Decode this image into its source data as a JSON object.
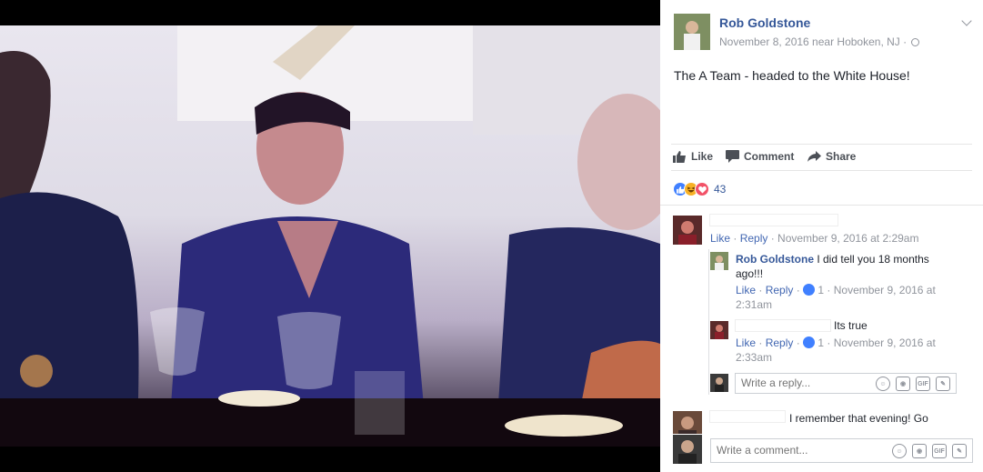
{
  "post": {
    "author": "Rob Goldstone",
    "date_location": "November 8, 2016 near Hoboken, NJ ·",
    "text": "The A Team - headed to the White House!"
  },
  "actions": {
    "like": "Like",
    "comment": "Comment",
    "share": "Share"
  },
  "reactions": {
    "count": "43",
    "types": [
      "like-icon",
      "haha-icon",
      "love-icon"
    ]
  },
  "comments": [
    {
      "links": {
        "like": "Like",
        "sep1": " · ",
        "reply": "Reply",
        "sep2": " · ",
        "time": "November 9, 2016 at 2:29am"
      },
      "replies": [
        {
          "author": "Rob Goldstone",
          "text_line1": "I did tell you 18 months",
          "text_line2": "ago!!!",
          "links": {
            "like": "Like",
            "sep1": " · ",
            "reply": "Reply",
            "sep2": " · ",
            "likes": "1",
            "sep3": " · ",
            "time_line1": "November 9, 2016 at",
            "time_line2": "2:31am"
          }
        },
        {
          "text": "Its true",
          "links": {
            "like": "Like",
            "sep1": " · ",
            "reply": "Reply",
            "sep2": " · ",
            "likes": "1",
            "sep3": " · ",
            "time_line1": "November 9, 2016 at",
            "time_line2": "2:33am"
          }
        }
      ],
      "reply_placeholder": "Write a reply..."
    },
    {
      "text": "I remember that evening! Go"
    }
  ],
  "composer": {
    "placeholder": "Write a comment..."
  },
  "input_icons": [
    "smiley-icon",
    "camera-icon",
    "gif-icon",
    "sticker-icon"
  ],
  "gif_label": "GIF",
  "colors": {
    "link": "#365899",
    "accent": "#4267b2",
    "meta": "#90949c"
  }
}
